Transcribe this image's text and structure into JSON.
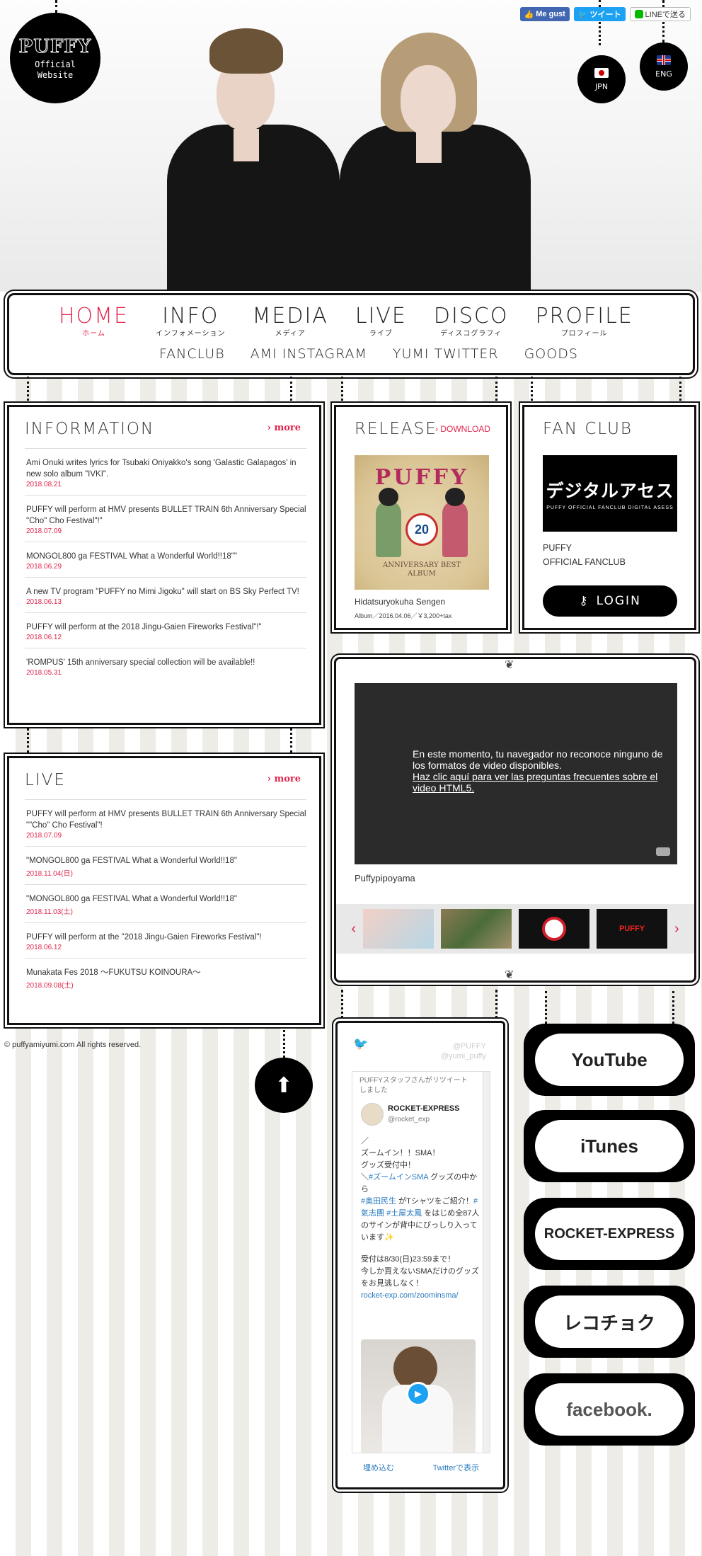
{
  "header": {
    "logo_brand": "PUFFY",
    "logo_sub_1": "Official",
    "logo_sub_2": "Website",
    "lang_jp": "JPN",
    "lang_en": "ENG",
    "social": {
      "facebook": "Me gust",
      "twitter": "ツイート",
      "line": "LINEで送る"
    }
  },
  "nav": {
    "main": [
      {
        "en": "HOME",
        "jp": "ホーム"
      },
      {
        "en": "INFO",
        "jp": "インフォメーション"
      },
      {
        "en": "MEDIA",
        "jp": "メディア"
      },
      {
        "en": "LIVE",
        "jp": "ライブ"
      },
      {
        "en": "DISCO",
        "jp": "ディスコグラフィ"
      },
      {
        "en": "PROFILE",
        "jp": "プロフィール"
      }
    ],
    "sub": [
      "FANCLUB",
      "AMI INSTAGRAM",
      "YUMI TWITTER",
      "GOODS"
    ]
  },
  "information": {
    "title": "INFORMATION",
    "more": "› more",
    "items": [
      {
        "text": "Ami Onuki writes lyrics for Tsubaki Oniyakko's song 'Galastic Galapagos' in new solo album \"IVKI\".",
        "date": "2018.08.21"
      },
      {
        "text": "PUFFY will perform at HMV presents BULLET TRAIN 6th Anniversary Special \"Cho\" Cho Festival\"!\"",
        "date": "2018.07.09"
      },
      {
        "text": "MONGOL800 ga FESTIVAL What a Wonderful World!!18\"\"",
        "date": "2018.06.29"
      },
      {
        "text": "A new TV program \"PUFFY no Mimi Jigoku\" will start on BS Sky Perfect TV!",
        "date": "2018.06.13"
      },
      {
        "text": "PUFFY will perform at the 2018 Jingu-Gaien Fireworks Festival\"!\"",
        "date": "2018.06.12"
      },
      {
        "text": "'ROMPUS' 15th anniversary special collection will be available!!",
        "date": "2018.05.31"
      }
    ]
  },
  "live": {
    "title": "LIVE",
    "more": "› more",
    "items": [
      {
        "text": "PUFFY will perform at HMV presents BULLET TRAIN 6th Anniversary Special \"\"Cho\" Cho Festival\"!",
        "date": "2018.07.09"
      },
      {
        "text": "\"MONGOL800 ga FESTIVAL What a Wonderful World!!18\"",
        "date": "2018.11.04(日)"
      },
      {
        "text": "\"MONGOL800 ga FESTIVAL What a Wonderful World!!18\"",
        "date": "2018.11.03(土)"
      },
      {
        "text": "PUFFY will perform at the \"2018 Jingu-Gaien Fireworks Festival\"!",
        "date": "2018.06.12"
      },
      {
        "text": "Munakata Fes 2018 〜FUKUTSU KOINOURA〜",
        "date": "2018.09.08(土)"
      }
    ]
  },
  "release": {
    "title": "RELEASE",
    "download": "› DOWNLOAD",
    "cover_title": "PUFFY",
    "cover_sub": "ANNIVERSARY BEST ALBUM",
    "cover_num": "20",
    "name": "Hidatsuryokuha Sengen",
    "meta": "Album／2016.04.06／￥3,200+tax"
  },
  "fanclub": {
    "title": "FAN CLUB",
    "banner_big": "デジタルアセス",
    "banner_small": "PUFFY OFFICIAL FANCLUB DIGITAL ASESS",
    "line1": "PUFFY",
    "line2": "OFFICIAL FANCLUB",
    "login": "LOGIN"
  },
  "video": {
    "message": "En este momento, tu navegador no reconoce ninguno de los formatos de video disponibles.",
    "link": "Haz clic aquí para ver las preguntas frecuentes sobre el video HTML5.",
    "caption": "Puffypipoyama",
    "thumb_labels": [
      "",
      "",
      "",
      "PUFFY"
    ]
  },
  "twitter": {
    "handle1": "@PUFFY",
    "handle2": "@yumi_puffy",
    "retweet": "PUFFYスタッフさんがリツイートしました",
    "author": "ROCKET-EXPRESS",
    "author_handle": "@rocket_exp",
    "tweet_1": "／",
    "tweet_2": "ズームイン！！SMA！",
    "tweet_3": "グッズ受付中！",
    "tweet_4a": "＼",
    "tweet_4b": "#ズームインSMA",
    "tweet_4c": " グッズの中から",
    "tweet_5a": "#奥田民生",
    "tweet_5b": " がTシャツをご紹介！",
    "tweet_5c": "#氣志團",
    "tweet_5d": "#土屋太鳳",
    "tweet_5e": " をはじめ全87人のサインが背中にびっしり入っています",
    "tweet_6": "受付は8/30(日)23:59まで！",
    "tweet_7": "今しか買えないSMAだけのグッズをお見逃しなく！",
    "tweet_link": "rocket-exp.com/zoominsma/",
    "embed": "埋め込む",
    "view": "Twitterで表示"
  },
  "sidelinks": [
    "YouTube",
    "iTunes",
    "ROCKET-EXPRESS",
    "レコチョク",
    "facebook."
  ],
  "footer": {
    "copyright": "© puffyamiyumi.com All rights reserved."
  },
  "colors": {
    "accent": "#e2264d",
    "ink": "#111111"
  }
}
